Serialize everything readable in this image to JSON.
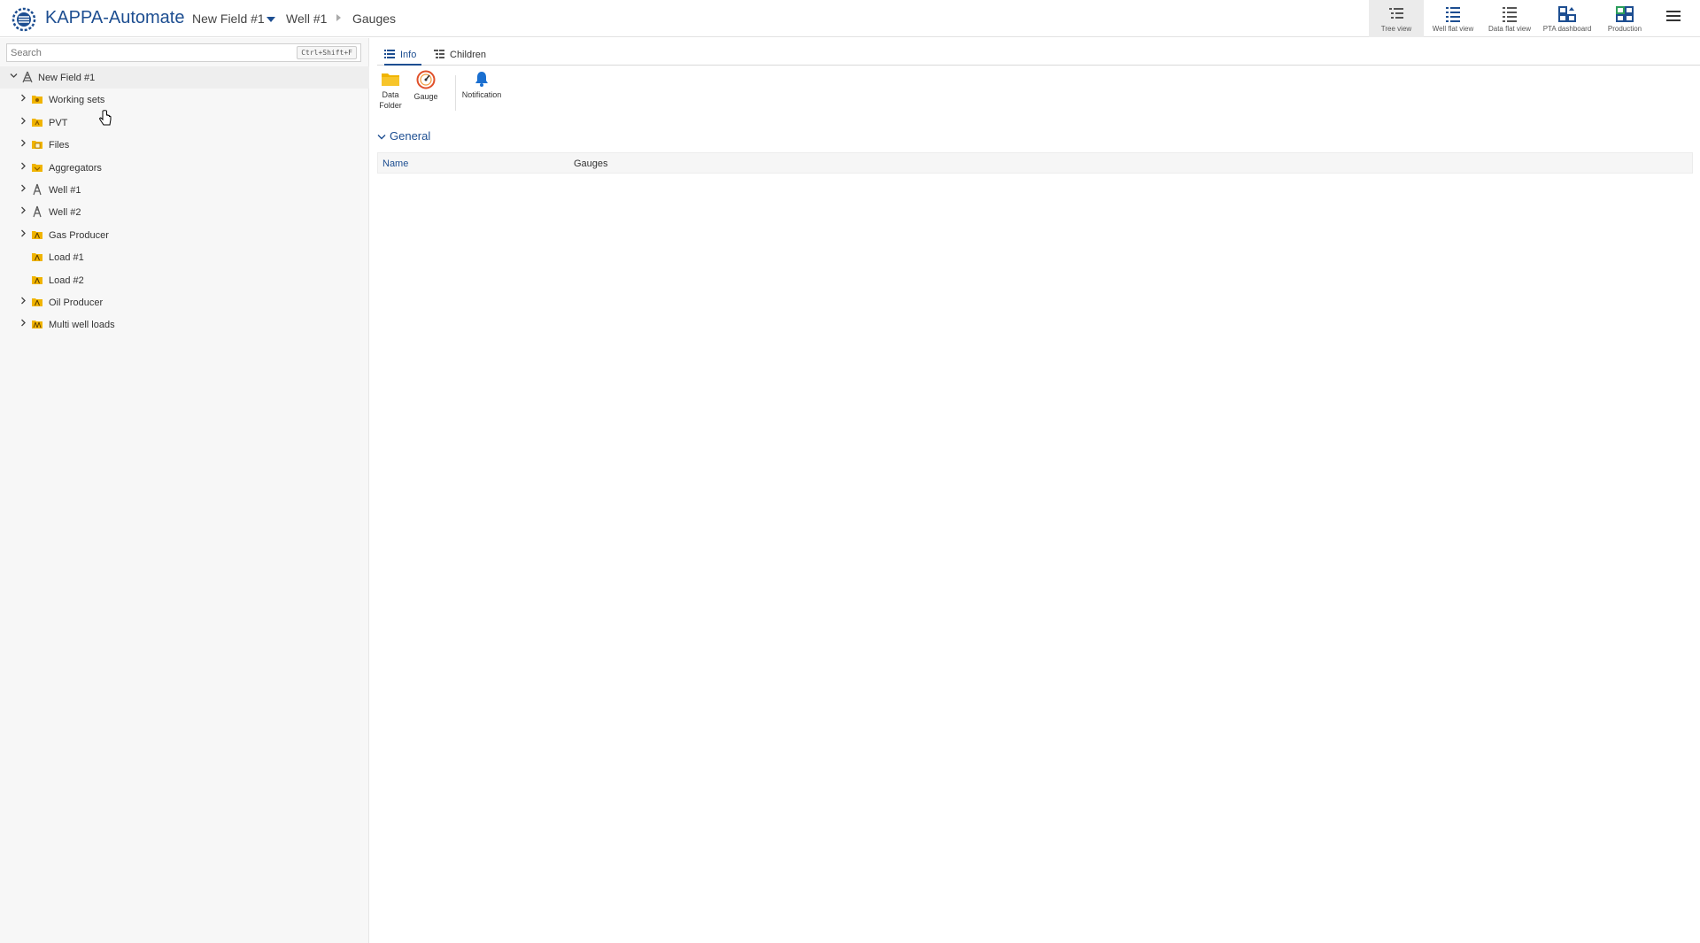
{
  "header": {
    "app_title": "KAPPA-Automate",
    "breadcrumb": {
      "field": "New Field #1",
      "well": "Well #1",
      "current": "Gauges"
    },
    "views": [
      {
        "label": "Tree view",
        "icon": "tree-view-icon",
        "active": true
      },
      {
        "label": "Well flat view",
        "icon": "well-flat-view-icon",
        "active": false
      },
      {
        "label": "Data flat view",
        "icon": "data-flat-view-icon",
        "active": false
      },
      {
        "label": "PTA dashboard",
        "icon": "pta-dashboard-icon",
        "active": false
      },
      {
        "label": "Production",
        "icon": "production-icon",
        "active": false
      }
    ]
  },
  "sidebar": {
    "search": {
      "placeholder": "Search",
      "value": "",
      "shortcut": "Ctrl+Shift+F"
    },
    "tree": {
      "root": {
        "label": "New Field #1",
        "icon": "field-icon",
        "expanded": true
      },
      "children": [
        {
          "label": "Working sets",
          "icon": "working-sets-folder-icon",
          "expandable": true
        },
        {
          "label": "PVT",
          "icon": "pvt-folder-icon",
          "expandable": true
        },
        {
          "label": "Files",
          "icon": "files-folder-icon",
          "expandable": true
        },
        {
          "label": "Aggregators",
          "icon": "aggregators-folder-icon",
          "expandable": true
        },
        {
          "label": "Well #1",
          "icon": "well-icon",
          "expandable": true
        },
        {
          "label": "Well #2",
          "icon": "well-icon",
          "expandable": true
        },
        {
          "label": "Gas Producer",
          "icon": "group-folder-icon",
          "expandable": true
        },
        {
          "label": "Load #1",
          "icon": "group-folder-icon",
          "expandable": false
        },
        {
          "label": "Load #2",
          "icon": "group-folder-icon",
          "expandable": false
        },
        {
          "label": "Oil Producer",
          "icon": "group-folder-icon",
          "expandable": true
        },
        {
          "label": "Multi well loads",
          "icon": "group-folder-icon",
          "expandable": true
        }
      ]
    }
  },
  "main": {
    "tabs": [
      {
        "label": "Info",
        "icon": "list-icon",
        "active": true
      },
      {
        "label": "Children",
        "icon": "children-icon",
        "active": false
      }
    ],
    "toolbar": {
      "data_folder_label_1": "Data",
      "data_folder_label_2": "Folder",
      "gauge_label": "Gauge",
      "notification_label": "Notification"
    },
    "section": {
      "title": "General",
      "expanded": true,
      "rows": [
        {
          "key": "Name",
          "value": "Gauges"
        }
      ]
    }
  },
  "colors": {
    "brand": "#1d4e91",
    "folder": "#f0b400",
    "sidebar_bg": "#f7f7f7",
    "notification": "#1a6fd0"
  }
}
